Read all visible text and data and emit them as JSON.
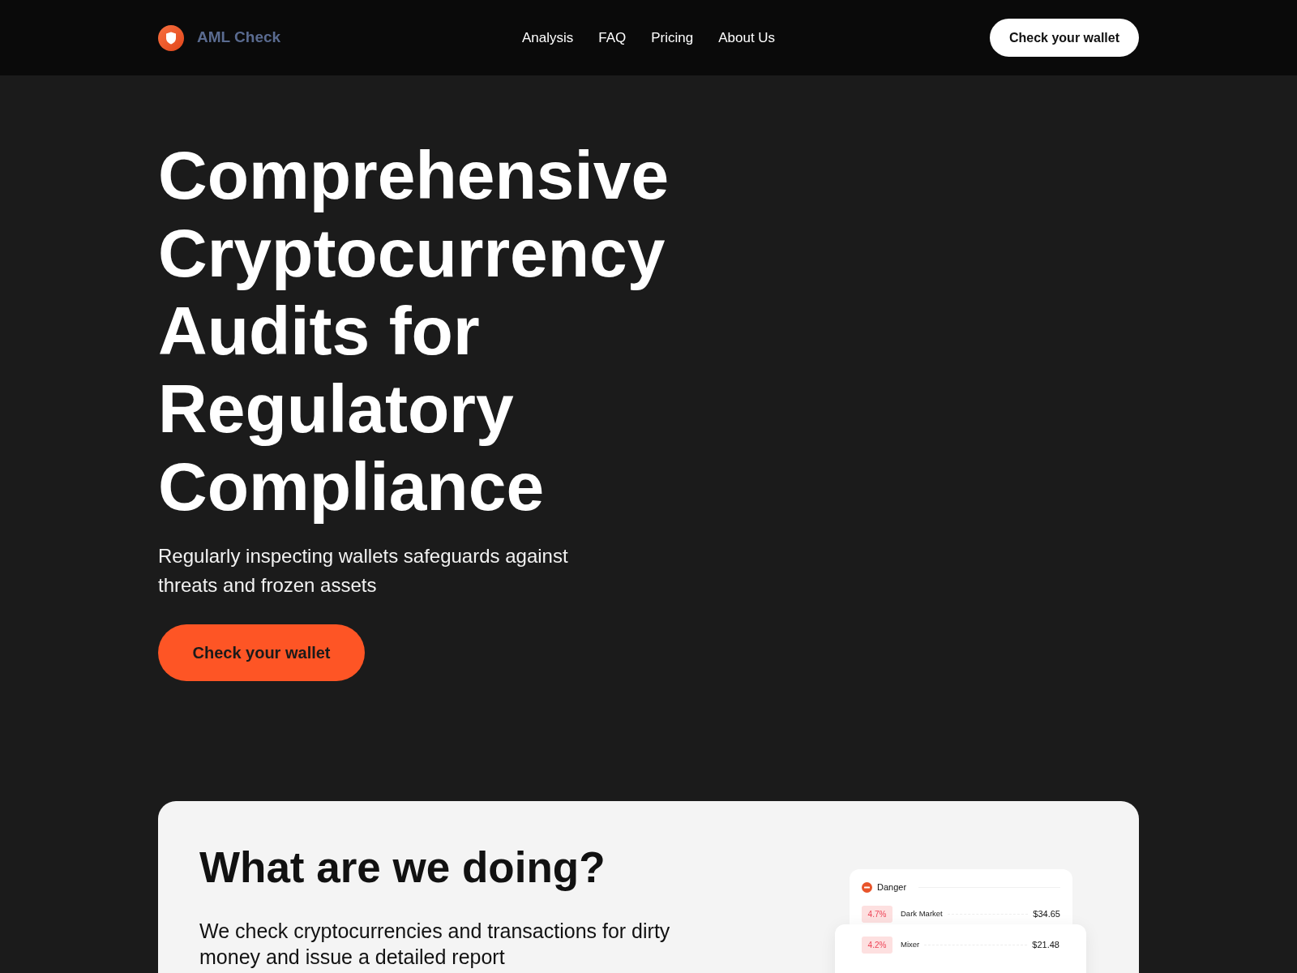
{
  "header": {
    "logo": {
      "text": "AML Check"
    },
    "nav": [
      {
        "label": "Analysis"
      },
      {
        "label": "FAQ"
      },
      {
        "label": "Pricing"
      },
      {
        "label": "About Us"
      }
    ],
    "button": "Check your wallet"
  },
  "hero": {
    "title": "Comprehensive Cryptocurrency Audits for Regulatory Compliance",
    "subtitle": "Regularly inspecting wallets safeguards against threats and frozen assets",
    "button": "Check your wallet"
  },
  "about": {
    "title": "What are we doing?",
    "text": "We check cryptocurrencies and transactions for dirty money and issue a detailed report",
    "risk_card": {
      "category": "Danger",
      "entries": [
        {
          "share": "4.7%",
          "label": "Dark Market",
          "amount": "$34.65"
        },
        {
          "share": "4.2%",
          "label": "Mixer",
          "amount": "$21.48"
        }
      ]
    }
  }
}
